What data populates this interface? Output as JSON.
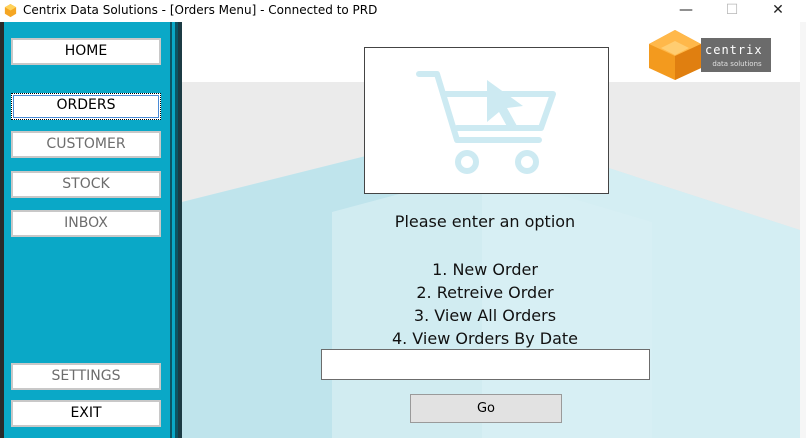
{
  "window": {
    "title": "Centrix Data Solutions - [Orders Menu] - Connected to PRD",
    "minimize": "—",
    "maximize": "☐",
    "close": "✕"
  },
  "sidebar": {
    "top_items": [
      {
        "label": "HOME",
        "state": "normal"
      },
      {
        "label": "ORDERS",
        "state": "selected"
      },
      {
        "label": "CUSTOMER",
        "state": "dim"
      },
      {
        "label": "STOCK",
        "state": "dim"
      },
      {
        "label": "INBOX",
        "state": "dim"
      }
    ],
    "bottom_items": [
      {
        "label": "SETTINGS",
        "state": "dim"
      },
      {
        "label": "EXIT",
        "state": "normal"
      }
    ]
  },
  "brand": {
    "name": "centrix",
    "tagline": "data solutions"
  },
  "main": {
    "icon": "shopping-cart-icon",
    "prompt": "Please enter an option",
    "options": [
      "1. New Order",
      "2. Retreive Order",
      "3. View All Orders",
      "4. View Orders By Date"
    ],
    "input_value": "",
    "go_label": "Go"
  },
  "colors": {
    "sidebar": "#0aa8c7",
    "cart": "#cdeaf2",
    "brand_orange": "#f39a1e"
  }
}
